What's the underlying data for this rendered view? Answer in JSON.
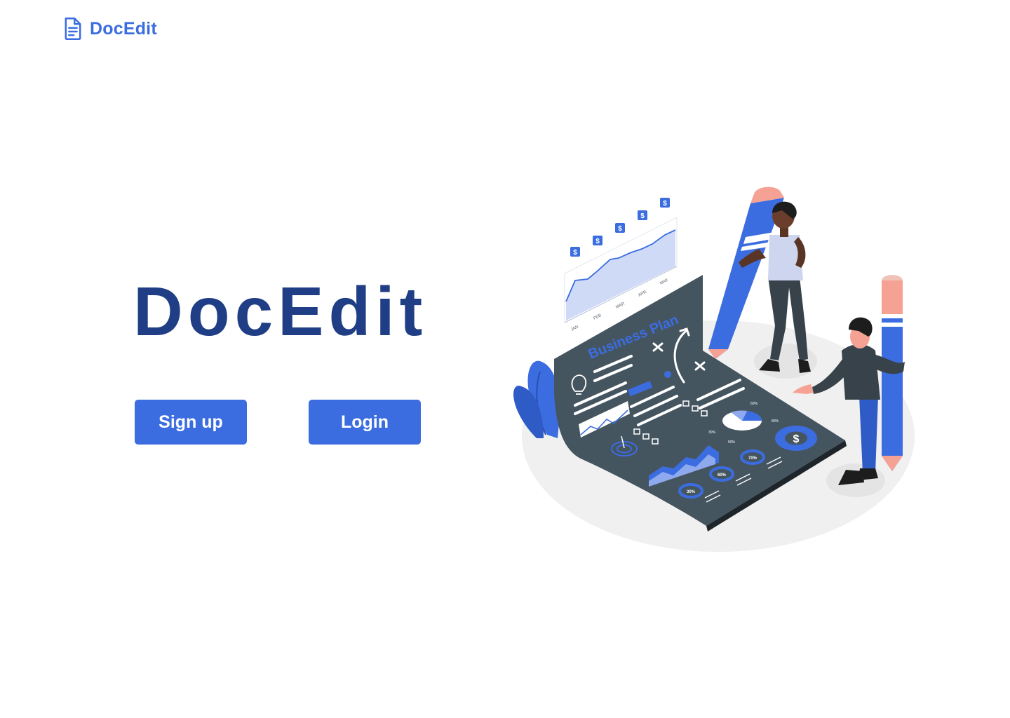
{
  "app": {
    "brand_name": "DocEdit",
    "brand_icon": "document-icon"
  },
  "hero": {
    "title": "DocEdit"
  },
  "actions": {
    "signup_label": "Sign up",
    "login_label": "Login"
  },
  "illustration": {
    "doc_title": "Business Plan",
    "months": [
      "JAN",
      "FEB",
      "MAR",
      "APR",
      "MAY"
    ],
    "currency_symbol": "$",
    "percentages": [
      "30%",
      "60%",
      "70%",
      "30%",
      "50%",
      "60%",
      "80%"
    ]
  },
  "colors": {
    "accent": "#3b6de0",
    "title": "#1f3e85",
    "doc": "#455560",
    "ground": "#f0f0f0"
  }
}
